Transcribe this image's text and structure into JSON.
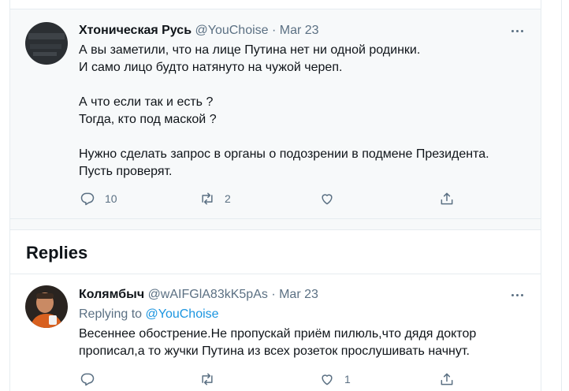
{
  "main_tweet": {
    "display_name": "Хтоническая Русь",
    "handle": "@YouChoise",
    "separator": "·",
    "date": "Mar 23",
    "text": "А вы заметили, что на лице Путина нет ни одной родинки.\nИ само лицо будто натянуто на чужой череп.\n\nА что если так и есть ?\nТогда, кто под маской ?\n\nНужно сделать запрос в органы о подозрении в подмене Президента.\nПусть проверят.",
    "reply_count": "10",
    "retweet_count": "2",
    "like_count": "",
    "icons": {
      "reply": "reply-icon",
      "retweet": "retweet-icon",
      "like": "heart-icon",
      "share": "share-icon",
      "more": "more-icon"
    }
  },
  "replies_section": {
    "title": "Replies"
  },
  "reply_tweet": {
    "display_name": "Колямбыч",
    "handle": "@wAIFGlA83kK5pAs",
    "separator": "·",
    "date": "Mar 23",
    "replying_prefix": "Replying to",
    "replying_to": "@YouChoise",
    "text": "Весеннее обострение.Не пропускай приём пилюль,что дядя доктор\nпрописал,а то жучки Путина из всех розеток прослушивать начнут.",
    "reply_count": "",
    "retweet_count": "",
    "like_count": "1"
  },
  "colors": {
    "text": "#0f1419",
    "secondary": "#5b7083",
    "link": "#1b95e0",
    "border": "#e6ecf0",
    "highlight_bg": "#f7f9fa"
  }
}
